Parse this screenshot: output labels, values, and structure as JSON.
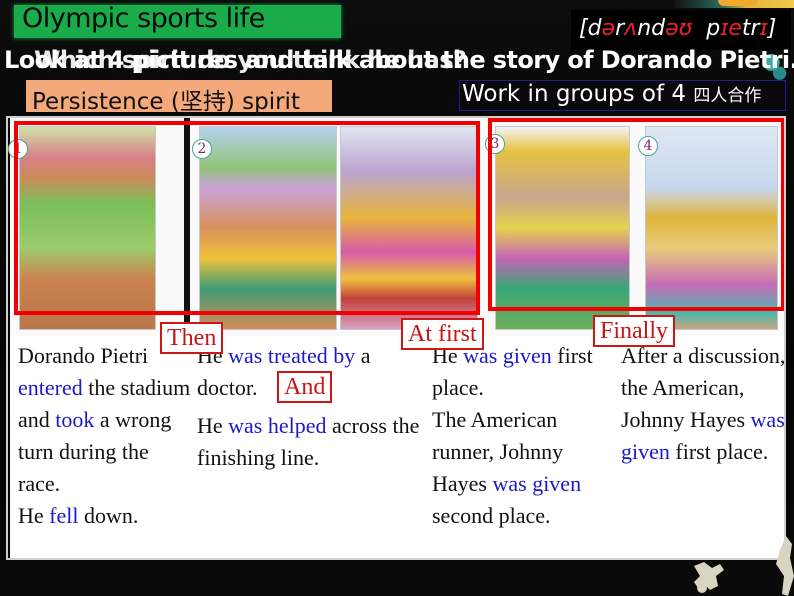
{
  "slide": {
    "title": "Olympic sports life",
    "phonetic": {
      "open": "[d",
      "parts": [
        {
          "t": "ə",
          "red": true
        },
        {
          "t": "r",
          "red": false
        },
        {
          "t": "ʌ",
          "red": true
        },
        {
          "t": "nd",
          "red": false
        },
        {
          "t": "əʊ",
          "red": true
        },
        {
          "t": "  p",
          "red": false
        },
        {
          "t": "ɪ",
          "red": true
        },
        {
          "t": "e",
          "red": true
        },
        {
          "t": "tr",
          "red": false
        },
        {
          "t": "ɪ",
          "red": true
        },
        {
          "t": "]",
          "red": false
        }
      ]
    },
    "question_overlap_a": "Look at 4 pictures and talk about the story of Dorando Pietri.",
    "question_overlap_b": "Which spirit do you think he has?",
    "spirit_label": "Persistence (坚持) spirit",
    "group_work": "Work in groups of 4",
    "group_work_cn": "四人合作"
  },
  "pictures": [
    {
      "number": "1",
      "description": "Runner on all fours on the track"
    },
    {
      "number": "2",
      "description": "Runner helped by a doctor"
    },
    {
      "number": "",
      "description": "Runner crossing the finish line"
    },
    {
      "number": "3",
      "description": "Runner 15 holding trophy beside runner 26"
    },
    {
      "number": "4",
      "description": "Runner 26 holding trophy"
    }
  ],
  "tags": {
    "then": "Then",
    "and": "And",
    "at_first": "At first",
    "finally": "Finally"
  },
  "columns": [
    {
      "segments": [
        {
          "t": "Dorando Pietri ",
          "v": false
        },
        {
          "t": "entered",
          "v": true
        },
        {
          "t": " the stadium and ",
          "v": false
        },
        {
          "t": "took",
          "v": true
        },
        {
          "t": " a wrong turn during the race.",
          "v": false
        }
      ],
      "line2": [
        {
          "t": "He ",
          "v": false
        },
        {
          "t": "fell",
          "v": true
        },
        {
          "t": " down.",
          "v": false
        }
      ]
    },
    {
      "segments": [
        {
          "t": "He ",
          "v": false
        },
        {
          "t": "was treated by",
          "v": true
        },
        {
          "t": " a doctor.",
          "v": false
        }
      ],
      "line2": [
        {
          "t": "He ",
          "v": false
        },
        {
          "t": "was helped",
          "v": true
        },
        {
          "t": " across the finishing line.",
          "v": false
        }
      ]
    },
    {
      "segments": [
        {
          "t": "He ",
          "v": false
        },
        {
          "t": "was given",
          "v": true
        },
        {
          "t": " first place.",
          "v": false
        }
      ],
      "line2": [
        {
          "t": "The American runner, Johnny Hayes ",
          "v": false
        },
        {
          "t": "was given",
          "v": true
        },
        {
          "t": " second place.",
          "v": false
        }
      ]
    },
    {
      "segments": [
        {
          "t": "After a discussion, the American, Johnny Hayes ",
          "v": false
        },
        {
          "t": "was given",
          "v": true
        },
        {
          "t": " first place.",
          "v": false
        }
      ],
      "line2": []
    }
  ],
  "colors": {
    "title_bg": "#1aab4b",
    "spirit_bg": "#f4a97a",
    "highlight_red": "#f00000",
    "verb_blue": "#1a1ac8",
    "tag_red": "#c81414"
  }
}
